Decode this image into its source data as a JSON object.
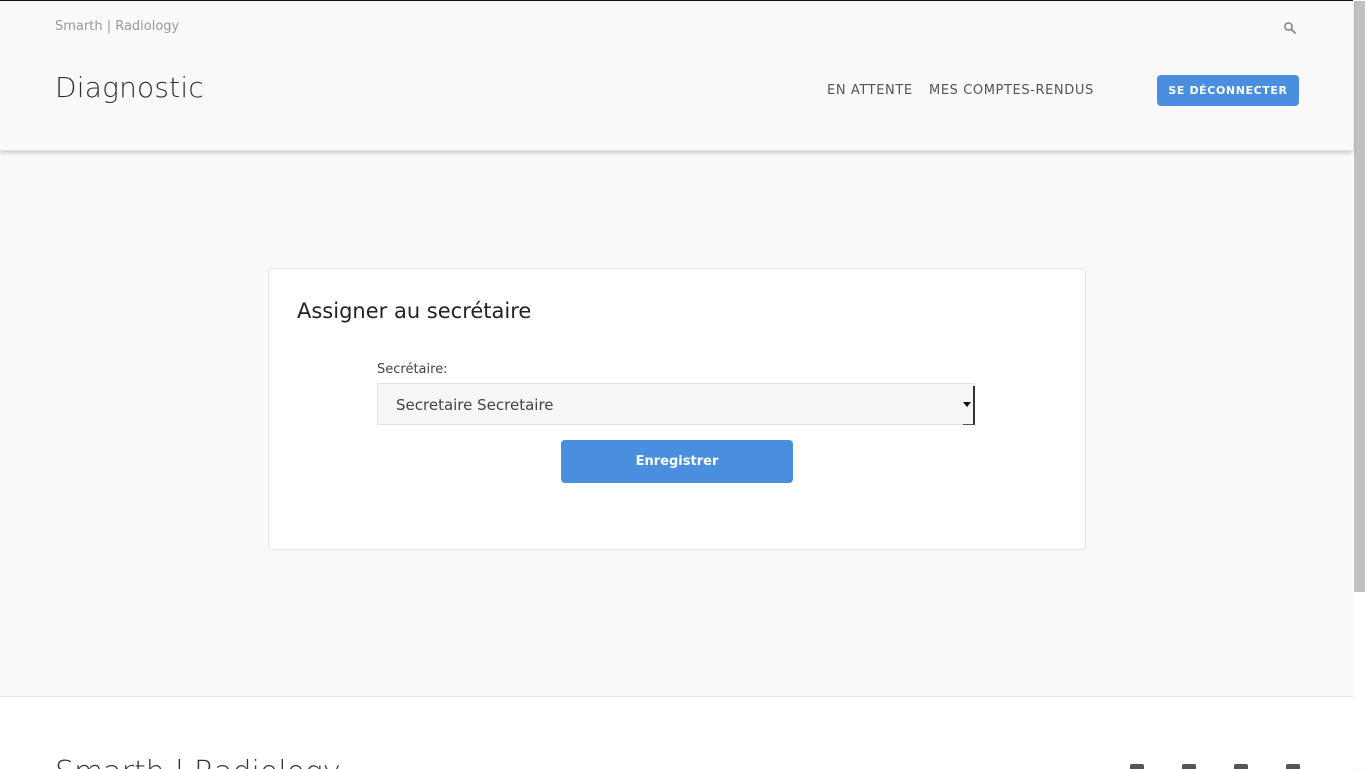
{
  "header": {
    "brand": "Smarth | Radiology",
    "title": "Diagnostic",
    "nav": [
      {
        "label": "EN ATTENTE"
      },
      {
        "label": "MES COMPTES-RENDUS"
      }
    ],
    "logout_label": "SE DÉCONNECTER",
    "search_icon": "search-icon"
  },
  "card": {
    "title": "Assigner au secrétaire",
    "field_label": "Secrétaire:",
    "select_value": "Secretaire Secretaire",
    "save_label": "Enregistrer"
  },
  "footer": {
    "title": "Smarth | Radiology"
  },
  "colors": {
    "accent": "#4a8ee0",
    "background": "#f9f9f9",
    "card": "#ffffff"
  }
}
